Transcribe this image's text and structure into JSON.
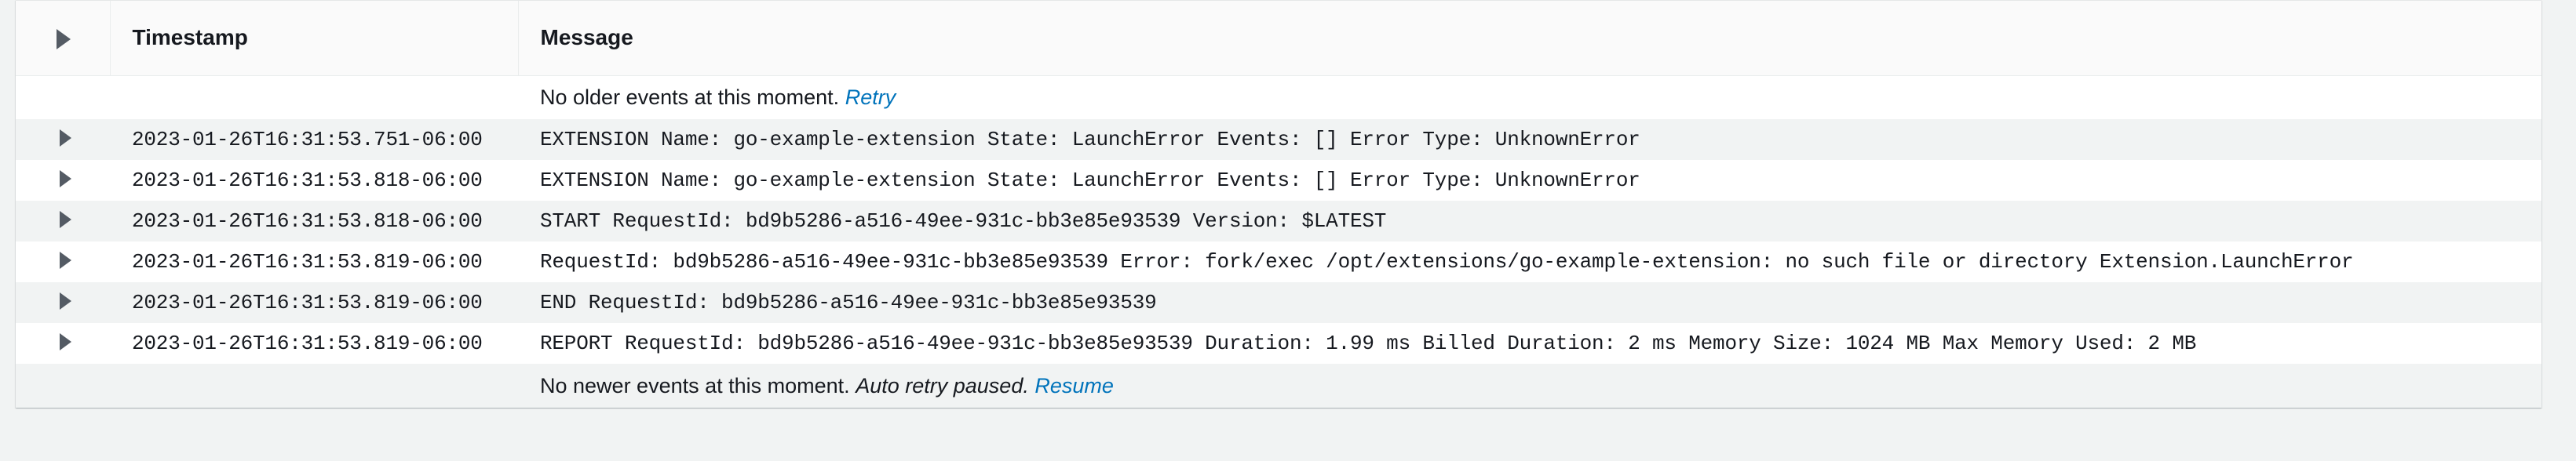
{
  "panel": {
    "columns": {
      "expand_header_icon": "caret-right-icon",
      "timestamp": "Timestamp",
      "message": "Message"
    },
    "notices": {
      "top": {
        "text": "No older events at this moment.",
        "link": "Retry"
      },
      "bottom": {
        "text": "No newer events at this moment.",
        "emphasis": "Auto retry paused.",
        "link": "Resume"
      }
    },
    "rows": [
      {
        "expand_icon": "caret-right-icon",
        "timestamp": "2023-01-26T16:31:53.751-06:00",
        "message": "EXTENSION Name: go-example-extension State: LaunchError Events: [] Error Type: UnknownError"
      },
      {
        "expand_icon": "caret-right-icon",
        "timestamp": "2023-01-26T16:31:53.818-06:00",
        "message": "EXTENSION Name: go-example-extension State: LaunchError Events: [] Error Type: UnknownError"
      },
      {
        "expand_icon": "caret-right-icon",
        "timestamp": "2023-01-26T16:31:53.818-06:00",
        "message": "START RequestId: bd9b5286-a516-49ee-931c-bb3e85e93539 Version: $LATEST"
      },
      {
        "expand_icon": "caret-right-icon",
        "timestamp": "2023-01-26T16:31:53.819-06:00",
        "message": "RequestId: bd9b5286-a516-49ee-931c-bb3e85e93539 Error: fork/exec /opt/extensions/go-example-extension: no such file or directory Extension.LaunchError"
      },
      {
        "expand_icon": "caret-right-icon",
        "timestamp": "2023-01-26T16:31:53.819-06:00",
        "message": "END RequestId: bd9b5286-a516-49ee-931c-bb3e85e93539"
      },
      {
        "expand_icon": "caret-right-icon",
        "timestamp": "2023-01-26T16:31:53.819-06:00",
        "message": "REPORT RequestId: bd9b5286-a516-49ee-931c-bb3e85e93539 Duration: 1.99 ms Billed Duration: 2 ms Memory Size: 1024 MB Max Memory Used: 2 MB"
      }
    ]
  },
  "colors": {
    "page_background": "#f1f3f3",
    "row_stripe": "#f1f3f3",
    "header_background": "#fafafa",
    "link": "#0073bb",
    "caret": "#545b64",
    "text": "#16191f"
  }
}
